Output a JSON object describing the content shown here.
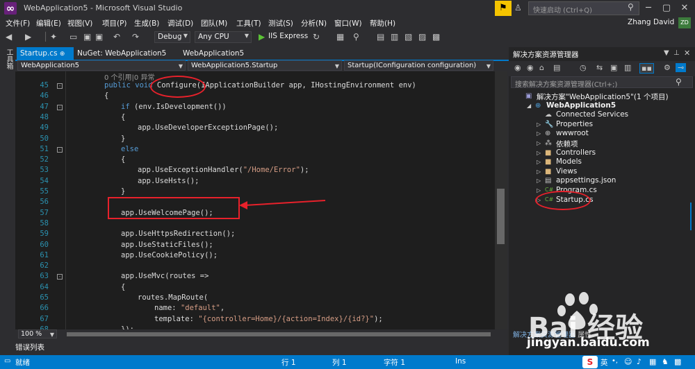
{
  "window": {
    "title": "WebApplication5 - Microsoft Visual Studio",
    "quick_launch_placeholder": "快速启动 (Ctrl+Q)",
    "user": "Zhang David",
    "avatar": "ZD"
  },
  "menu": [
    "文件(F)",
    "编辑(E)",
    "视图(V)",
    "项目(P)",
    "生成(B)",
    "调试(D)",
    "团队(M)",
    "工具(T)",
    "测试(S)",
    "分析(N)",
    "窗口(W)",
    "帮助(H)"
  ],
  "toolbar": {
    "config": "Debug",
    "platform": "Any CPU",
    "run_label": "IIS Express"
  },
  "left_strip_label": "工具箱",
  "tabs": [
    {
      "label": "Startup.cs",
      "pin": "⊕ ×"
    },
    {
      "label": "NuGet: WebApplication5"
    },
    {
      "label": "WebApplication5"
    }
  ],
  "nav": {
    "project": "WebApplication5",
    "class": "WebApplication5.Startup",
    "member": "Startup(IConfiguration configuration)"
  },
  "code": {
    "codelens": "0 个引用|0 异常",
    "lines": [
      {
        "n": "45",
        "t": "public void Configure(IApplicationBuilder app, IHostingEnvironment env)",
        "indent": 0,
        "collapse": "-"
      },
      {
        "n": "46",
        "t": "{",
        "indent": 0
      },
      {
        "n": "47",
        "t": "if (env.IsDevelopment())",
        "indent": 1,
        "collapse": "-"
      },
      {
        "n": "48",
        "t": "{",
        "indent": 1
      },
      {
        "n": "49",
        "t": "app.UseDeveloperExceptionPage();",
        "indent": 2
      },
      {
        "n": "50",
        "t": "}",
        "indent": 1
      },
      {
        "n": "51",
        "t": "else",
        "indent": 1,
        "collapse": "-"
      },
      {
        "n": "52",
        "t": "{",
        "indent": 1
      },
      {
        "n": "53",
        "t": "app.UseExceptionHandler(\"/Home/Error\");",
        "indent": 2
      },
      {
        "n": "54",
        "t": "app.UseHsts();",
        "indent": 2
      },
      {
        "n": "55",
        "t": "}",
        "indent": 1
      },
      {
        "n": "56",
        "t": "",
        "indent": 0
      },
      {
        "n": "57",
        "t": "app.UseWelcomePage();",
        "indent": 1
      },
      {
        "n": "58",
        "t": "",
        "indent": 0
      },
      {
        "n": "59",
        "t": "app.UseHttpsRedirection();",
        "indent": 1
      },
      {
        "n": "60",
        "t": "app.UseStaticFiles();",
        "indent": 1
      },
      {
        "n": "61",
        "t": "app.UseCookiePolicy();",
        "indent": 1
      },
      {
        "n": "62",
        "t": "",
        "indent": 0
      },
      {
        "n": "63",
        "t": "app.UseMvc(routes =>",
        "indent": 1,
        "collapse": "-"
      },
      {
        "n": "64",
        "t": "{",
        "indent": 1
      },
      {
        "n": "65",
        "t": "routes.MapRoute(",
        "indent": 2
      },
      {
        "n": "66",
        "t": "name: \"default\",",
        "indent": 3
      },
      {
        "n": "67",
        "t": "template: \"{controller=Home}/{action=Index}/{id?}\");",
        "indent": 3
      },
      {
        "n": "68",
        "t": "});",
        "indent": 1
      }
    ]
  },
  "zoom": "100 %",
  "error_list": "错误列表",
  "solution_explorer": {
    "title": "解决方案资源管理器",
    "search_placeholder": "搜索解决方案资源管理器(Ctrl+;)",
    "items": [
      {
        "label": "解决方案\"WebApplication5\"(1 个项目)",
        "level": 0,
        "icon": "solution-icon",
        "glyph": "▣",
        "color": "#9b9bd6",
        "arrow": ""
      },
      {
        "label": "WebApplication5",
        "level": 1,
        "icon": "web-project-icon",
        "glyph": "⊕",
        "color": "#4fa3e0",
        "arrow": "◢",
        "bold": true
      },
      {
        "label": "Connected Services",
        "level": 2,
        "icon": "connected-services-icon",
        "glyph": "☁",
        "color": "#c5c5c5",
        "arrow": ""
      },
      {
        "label": "Properties",
        "level": 2,
        "icon": "wrench-icon",
        "glyph": "🔧",
        "color": "#c5c5c5",
        "arrow": "▷"
      },
      {
        "label": "wwwroot",
        "level": 2,
        "icon": "globe-icon",
        "glyph": "⊕",
        "color": "#c5c5c5",
        "arrow": "▷"
      },
      {
        "label": "依赖项",
        "level": 2,
        "icon": "dependencies-icon",
        "glyph": "⁂",
        "color": "#c5c5c5",
        "arrow": "▷"
      },
      {
        "label": "Controllers",
        "level": 2,
        "icon": "folder-icon",
        "glyph": "■",
        "color": "#dcb67a",
        "arrow": "▷"
      },
      {
        "label": "Models",
        "level": 2,
        "icon": "folder-icon",
        "glyph": "■",
        "color": "#dcb67a",
        "arrow": "▷"
      },
      {
        "label": "Views",
        "level": 2,
        "icon": "folder-icon",
        "glyph": "■",
        "color": "#dcb67a",
        "arrow": "▷"
      },
      {
        "label": "appsettings.json",
        "level": 2,
        "icon": "json-file-icon",
        "glyph": "▤",
        "color": "#c5c5c5",
        "arrow": "▷"
      },
      {
        "label": "Program.cs",
        "level": 2,
        "icon": "csharp-file-icon",
        "glyph": "C#",
        "color": "#68b040",
        "arrow": "▷"
      },
      {
        "label": "Startup.cs",
        "level": 2,
        "icon": "csharp-file-icon",
        "glyph": "C#",
        "color": "#68b040",
        "arrow": "▷"
      }
    ],
    "bottom_tabs": [
      "解决方案资源管理器",
      "属性"
    ]
  },
  "status": {
    "ready": "就绪",
    "line": "行 1",
    "col": "列 1",
    "char": "字符 1",
    "ins": "Ins"
  },
  "watermark": {
    "brand": "Bai 经验",
    "url": "jingyan.baidu.com"
  },
  "colors": {
    "accent": "#007acc",
    "annotation": "#e8212b",
    "editor_bg": "#1e1e1e"
  }
}
